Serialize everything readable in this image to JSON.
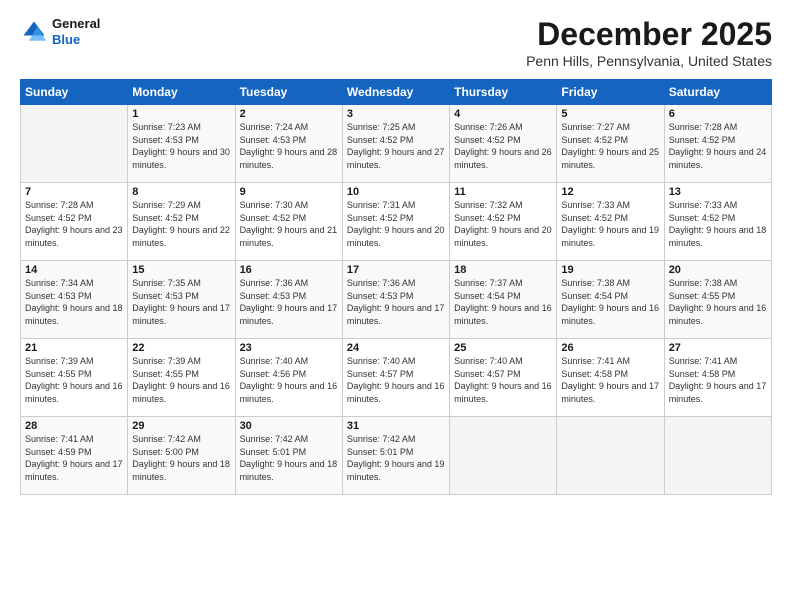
{
  "header": {
    "logo_line1": "General",
    "logo_line2": "Blue",
    "month": "December 2025",
    "location": "Penn Hills, Pennsylvania, United States"
  },
  "weekdays": [
    "Sunday",
    "Monday",
    "Tuesday",
    "Wednesday",
    "Thursday",
    "Friday",
    "Saturday"
  ],
  "weeks": [
    [
      {
        "day": "",
        "sunrise": "",
        "sunset": "",
        "daylight": ""
      },
      {
        "day": "1",
        "sunrise": "Sunrise: 7:23 AM",
        "sunset": "Sunset: 4:53 PM",
        "daylight": "Daylight: 9 hours and 30 minutes."
      },
      {
        "day": "2",
        "sunrise": "Sunrise: 7:24 AM",
        "sunset": "Sunset: 4:53 PM",
        "daylight": "Daylight: 9 hours and 28 minutes."
      },
      {
        "day": "3",
        "sunrise": "Sunrise: 7:25 AM",
        "sunset": "Sunset: 4:52 PM",
        "daylight": "Daylight: 9 hours and 27 minutes."
      },
      {
        "day": "4",
        "sunrise": "Sunrise: 7:26 AM",
        "sunset": "Sunset: 4:52 PM",
        "daylight": "Daylight: 9 hours and 26 minutes."
      },
      {
        "day": "5",
        "sunrise": "Sunrise: 7:27 AM",
        "sunset": "Sunset: 4:52 PM",
        "daylight": "Daylight: 9 hours and 25 minutes."
      },
      {
        "day": "6",
        "sunrise": "Sunrise: 7:28 AM",
        "sunset": "Sunset: 4:52 PM",
        "daylight": "Daylight: 9 hours and 24 minutes."
      }
    ],
    [
      {
        "day": "7",
        "sunrise": "Sunrise: 7:28 AM",
        "sunset": "Sunset: 4:52 PM",
        "daylight": "Daylight: 9 hours and 23 minutes."
      },
      {
        "day": "8",
        "sunrise": "Sunrise: 7:29 AM",
        "sunset": "Sunset: 4:52 PM",
        "daylight": "Daylight: 9 hours and 22 minutes."
      },
      {
        "day": "9",
        "sunrise": "Sunrise: 7:30 AM",
        "sunset": "Sunset: 4:52 PM",
        "daylight": "Daylight: 9 hours and 21 minutes."
      },
      {
        "day": "10",
        "sunrise": "Sunrise: 7:31 AM",
        "sunset": "Sunset: 4:52 PM",
        "daylight": "Daylight: 9 hours and 20 minutes."
      },
      {
        "day": "11",
        "sunrise": "Sunrise: 7:32 AM",
        "sunset": "Sunset: 4:52 PM",
        "daylight": "Daylight: 9 hours and 20 minutes."
      },
      {
        "day": "12",
        "sunrise": "Sunrise: 7:33 AM",
        "sunset": "Sunset: 4:52 PM",
        "daylight": "Daylight: 9 hours and 19 minutes."
      },
      {
        "day": "13",
        "sunrise": "Sunrise: 7:33 AM",
        "sunset": "Sunset: 4:52 PM",
        "daylight": "Daylight: 9 hours and 18 minutes."
      }
    ],
    [
      {
        "day": "14",
        "sunrise": "Sunrise: 7:34 AM",
        "sunset": "Sunset: 4:53 PM",
        "daylight": "Daylight: 9 hours and 18 minutes."
      },
      {
        "day": "15",
        "sunrise": "Sunrise: 7:35 AM",
        "sunset": "Sunset: 4:53 PM",
        "daylight": "Daylight: 9 hours and 17 minutes."
      },
      {
        "day": "16",
        "sunrise": "Sunrise: 7:36 AM",
        "sunset": "Sunset: 4:53 PM",
        "daylight": "Daylight: 9 hours and 17 minutes."
      },
      {
        "day": "17",
        "sunrise": "Sunrise: 7:36 AM",
        "sunset": "Sunset: 4:53 PM",
        "daylight": "Daylight: 9 hours and 17 minutes."
      },
      {
        "day": "18",
        "sunrise": "Sunrise: 7:37 AM",
        "sunset": "Sunset: 4:54 PM",
        "daylight": "Daylight: 9 hours and 16 minutes."
      },
      {
        "day": "19",
        "sunrise": "Sunrise: 7:38 AM",
        "sunset": "Sunset: 4:54 PM",
        "daylight": "Daylight: 9 hours and 16 minutes."
      },
      {
        "day": "20",
        "sunrise": "Sunrise: 7:38 AM",
        "sunset": "Sunset: 4:55 PM",
        "daylight": "Daylight: 9 hours and 16 minutes."
      }
    ],
    [
      {
        "day": "21",
        "sunrise": "Sunrise: 7:39 AM",
        "sunset": "Sunset: 4:55 PM",
        "daylight": "Daylight: 9 hours and 16 minutes."
      },
      {
        "day": "22",
        "sunrise": "Sunrise: 7:39 AM",
        "sunset": "Sunset: 4:55 PM",
        "daylight": "Daylight: 9 hours and 16 minutes."
      },
      {
        "day": "23",
        "sunrise": "Sunrise: 7:40 AM",
        "sunset": "Sunset: 4:56 PM",
        "daylight": "Daylight: 9 hours and 16 minutes."
      },
      {
        "day": "24",
        "sunrise": "Sunrise: 7:40 AM",
        "sunset": "Sunset: 4:57 PM",
        "daylight": "Daylight: 9 hours and 16 minutes."
      },
      {
        "day": "25",
        "sunrise": "Sunrise: 7:40 AM",
        "sunset": "Sunset: 4:57 PM",
        "daylight": "Daylight: 9 hours and 16 minutes."
      },
      {
        "day": "26",
        "sunrise": "Sunrise: 7:41 AM",
        "sunset": "Sunset: 4:58 PM",
        "daylight": "Daylight: 9 hours and 17 minutes."
      },
      {
        "day": "27",
        "sunrise": "Sunrise: 7:41 AM",
        "sunset": "Sunset: 4:58 PM",
        "daylight": "Daylight: 9 hours and 17 minutes."
      }
    ],
    [
      {
        "day": "28",
        "sunrise": "Sunrise: 7:41 AM",
        "sunset": "Sunset: 4:59 PM",
        "daylight": "Daylight: 9 hours and 17 minutes."
      },
      {
        "day": "29",
        "sunrise": "Sunrise: 7:42 AM",
        "sunset": "Sunset: 5:00 PM",
        "daylight": "Daylight: 9 hours and 18 minutes."
      },
      {
        "day": "30",
        "sunrise": "Sunrise: 7:42 AM",
        "sunset": "Sunset: 5:01 PM",
        "daylight": "Daylight: 9 hours and 18 minutes."
      },
      {
        "day": "31",
        "sunrise": "Sunrise: 7:42 AM",
        "sunset": "Sunset: 5:01 PM",
        "daylight": "Daylight: 9 hours and 19 minutes."
      },
      {
        "day": "",
        "sunrise": "",
        "sunset": "",
        "daylight": ""
      },
      {
        "day": "",
        "sunrise": "",
        "sunset": "",
        "daylight": ""
      },
      {
        "day": "",
        "sunrise": "",
        "sunset": "",
        "daylight": ""
      }
    ]
  ]
}
